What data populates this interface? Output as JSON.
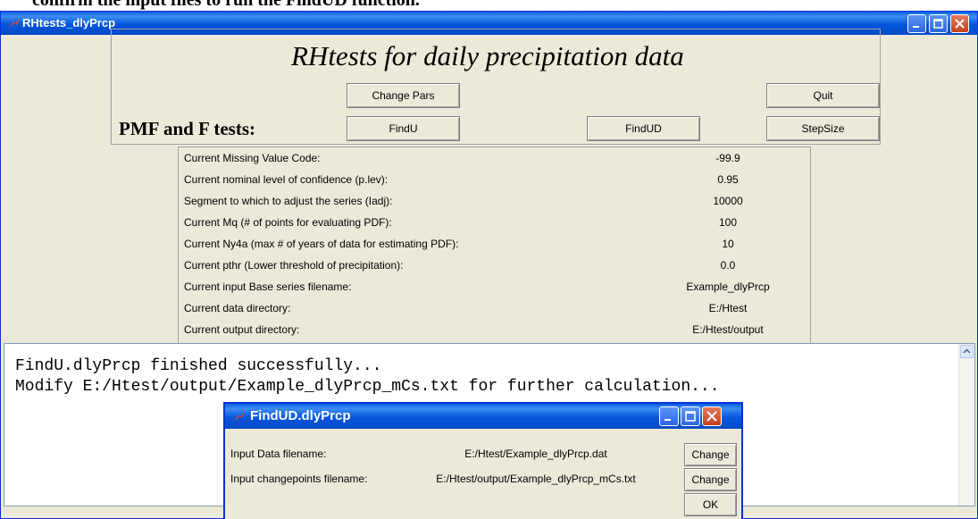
{
  "doc_text": "confirm the input files to run the FindUD function.",
  "window": {
    "title": "RHtests_dlyPrcp"
  },
  "header": {
    "title": "RHtests for daily precipitation data",
    "section_label": "PMF and F tests:"
  },
  "buttons": {
    "change_pars": "Change Pars",
    "quit": "Quit",
    "findu": "FindU",
    "findud": "FindUD",
    "stepsize": "StepSize"
  },
  "params": [
    {
      "label": "Current Missing Value Code:",
      "value": "-99.9"
    },
    {
      "label": "Current nominal level of confidence (p.lev):",
      "value": "0.95"
    },
    {
      "label": "Segment to which to adjust the series (Iadj):",
      "value": "10000"
    },
    {
      "label": "Current Mq (# of points for evaluating PDF):",
      "value": "100"
    },
    {
      "label": "Current Ny4a (max # of years of data for estimating PDF):",
      "value": "10"
    },
    {
      "label": "Current pthr (Lower threshold of precipitation):",
      "value": "0.0"
    },
    {
      "label": "Current input Base series filename:",
      "value": "Example_dlyPrcp"
    },
    {
      "label": "Current data directory:",
      "value": "E:/Htest"
    },
    {
      "label": "Current output directory:",
      "value": "E:/Htest/output"
    }
  ],
  "console": {
    "lines": [
      "FindU.dlyPrcp finished successfully...",
      "Modify E:/Htest/output/Example_dlyPrcp_mCs.txt for further calculation..."
    ]
  },
  "dialog": {
    "title": "FindUD.dlyPrcp",
    "rows": [
      {
        "label": "Input Data filename:",
        "value": "E:/Htest/Example_dlyPrcp.dat",
        "button": "Change"
      },
      {
        "label": "Input changepoints filename:",
        "value": "E:/Htest/output/Example_dlyPrcp_mCs.txt",
        "button": "Change"
      }
    ],
    "ok_label": "OK"
  },
  "colors": {
    "titlebar": "#0556dc",
    "window_bg": "#ece9d8",
    "close": "#c4411c"
  },
  "icons": [
    "tk-feather-icon",
    "minimize-icon",
    "maximize-icon",
    "close-icon",
    "scroll-up-arrow-icon"
  ]
}
